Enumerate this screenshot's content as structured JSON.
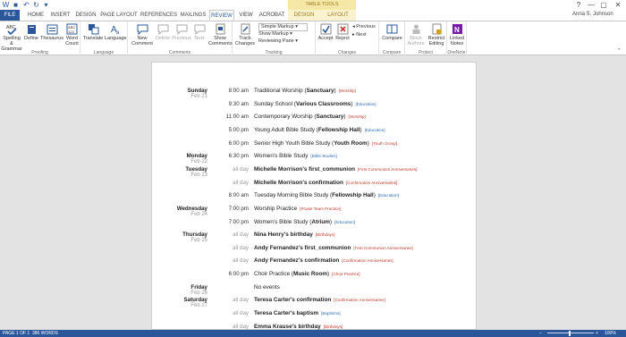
{
  "window": {
    "title": "Events (1) - Word",
    "table_tools": "TABLE TOOLS",
    "controls": [
      "?",
      "—",
      "▢",
      "✕"
    ]
  },
  "tabs": [
    "FILE",
    "HOME",
    "INSERT",
    "DESIGN",
    "PAGE LAYOUT",
    "REFERENCES",
    "MAILINGS",
    "REVIEW",
    "VIEW",
    "ACROBAT",
    "DESIGN",
    "LAYOUT"
  ],
  "user": "Anna S. Johnson",
  "ribbon": {
    "groups": {
      "proofing": "Proofing",
      "language": "Language",
      "comments": "Comments",
      "tracking": "Tracking",
      "changes": "Changes",
      "compare": "Compare",
      "protect": "Protect",
      "onenote": "OneNote"
    },
    "buttons": {
      "spelling": "Spelling & Grammar",
      "define": "Define",
      "thesaurus": "Thesaurus",
      "word_count": "Word Count",
      "translate": "Translate",
      "language": "Language",
      "new_comment": "New Comment",
      "delete": "Delete",
      "previous": "Previous",
      "next": "Next",
      "show_comments": "Show Comments",
      "track_changes": "Track Changes",
      "accept": "Accept",
      "reject": "Reject",
      "prev_change": "Previous",
      "next_change": "Next",
      "compare": "Compare",
      "block_authors": "Block Authors",
      "restrict_editing": "Restrict Editing",
      "linked_notes": "Linked Notes"
    },
    "tracking": {
      "markup_select": "Simple Markup",
      "show_markup": "Show Markup",
      "reviewing_pane": "Reviewing Pane"
    },
    "icons": {
      "spelling": "abc-check-icon",
      "define": "book-icon",
      "thesaurus": "thesaurus-icon",
      "word_count": "abc-123-icon",
      "translate": "translate-icon",
      "language": "language-icon",
      "new_comment": "comment-icon",
      "track_changes": "track-changes-icon",
      "accept": "checkmark-icon",
      "reject": "reject-icon",
      "compare": "compare-icon",
      "block_authors": "block-authors-icon",
      "restrict_editing": "lock-icon",
      "linked_notes": "onenote-icon"
    }
  },
  "schedule": [
    {
      "day": "Sunday",
      "date": "Feb 21",
      "time": "8:00 am",
      "event": "Traditional Worship",
      "location": "Sanctuary",
      "category": "[Worship]",
      "cat_color": "#c0392b",
      "allday": false
    },
    {
      "day": "",
      "date": "",
      "time": "9:30 am",
      "event": "Sunday School",
      "location": "Various Classrooms",
      "category": "[Education]",
      "cat_color": "#2d6db5",
      "allday": false
    },
    {
      "day": "",
      "date": "",
      "time": "11:00 am",
      "event": "Contemporary Worship",
      "location": "Sanctuary",
      "category": "[Worship]",
      "cat_color": "#c0392b",
      "allday": false
    },
    {
      "day": "",
      "date": "",
      "time": "5:00 pm",
      "event": "Young Adult Bible Study",
      "location": "Fellowship Hall",
      "category": "[Education]",
      "cat_color": "#2d6db5",
      "allday": false
    },
    {
      "day": "",
      "date": "",
      "time": "6:00 pm",
      "event": "Senior High Youth Bible Study",
      "location": "Youth Room",
      "category": "[Youth Group]",
      "cat_color": "#c0392b",
      "allday": false
    },
    {
      "day": "Monday",
      "date": "Feb 22",
      "time": "6:30 pm",
      "event": "Women's Bible Study",
      "location": "",
      "category": "[Bible Studies]",
      "cat_color": "#2d6db5",
      "allday": false
    },
    {
      "day": "Tuesday",
      "date": "Feb 23",
      "time": "all day",
      "event": "Michelle Morrison's first_communion",
      "location": "",
      "category": "[First Communion Anniversaries]",
      "cat_color": "#c0392b",
      "allday": true
    },
    {
      "day": "",
      "date": "",
      "time": "all day",
      "event": "Michelle Morrison's confirmation",
      "location": "",
      "category": "[Confirmation Anniversaries]",
      "cat_color": "#c0392b",
      "allday": true
    },
    {
      "day": "",
      "date": "",
      "time": "8:00 am",
      "event": "Tuesday Morning Bible Study",
      "location": "Fellowship Hall",
      "category": "[Education]",
      "cat_color": "#2d6db5",
      "allday": false
    },
    {
      "day": "Wednesday",
      "date": "Feb 24",
      "time": "7:00 pm",
      "event": "Worship Practice",
      "location": "",
      "category": "[Praise Team Practice]",
      "cat_color": "#c0392b",
      "allday": false
    },
    {
      "day": "",
      "date": "",
      "time": "7:00 pm",
      "event": "Women's Bible Study",
      "location": "Atrium",
      "category": "[Education]",
      "cat_color": "#2d6db5",
      "allday": false
    },
    {
      "day": "Thursday",
      "date": "Feb 25",
      "time": "all day",
      "event": "Nina Henry's birthday",
      "location": "",
      "category": "[Birthdays]",
      "cat_color": "#c0392b",
      "allday": true
    },
    {
      "day": "",
      "date": "",
      "time": "all day",
      "event": "Andy Fernandez's first_communion",
      "location": "",
      "category": "[First Communion Anniversaries]",
      "cat_color": "#c0392b",
      "allday": true
    },
    {
      "day": "",
      "date": "",
      "time": "all day",
      "event": "Andy Fernandez's confirmation",
      "location": "",
      "category": "[Confirmation Anniversaries]",
      "cat_color": "#c0392b",
      "allday": true
    },
    {
      "day": "",
      "date": "",
      "time": "6:00 pm",
      "event": "Choir Practice",
      "location": "Music Room",
      "category": "[Choir Practice]",
      "cat_color": "#c0392b",
      "allday": false
    },
    {
      "day": "Friday",
      "date": "Feb 26",
      "time": "",
      "event": "No events",
      "location": "",
      "category": "",
      "cat_color": "#c0392b",
      "allday": false
    },
    {
      "day": "Saturday",
      "date": "Feb 27",
      "time": "all day",
      "event": "Teresa Carter's confirmation",
      "location": "",
      "category": "[Confirmation Anniversaries]",
      "cat_color": "#c0392b",
      "allday": true
    },
    {
      "day": "",
      "date": "",
      "time": "all day",
      "event": "Teresa Carter's baptism",
      "location": "",
      "category": "[Baptisms]",
      "cat_color": "#2d6db5",
      "allday": true
    },
    {
      "day": "",
      "date": "",
      "time": "all day",
      "event": "Emma Krause's birthday",
      "location": "",
      "category": "[Birthdays]",
      "cat_color": "#c0392b",
      "allday": true
    }
  ],
  "status": {
    "page": "PAGE 1 OF 1",
    "words": "386 WORDS",
    "zoom": "100%"
  },
  "colors": {
    "accent": "#2b579a",
    "context_tab": "#f5e7a6"
  }
}
